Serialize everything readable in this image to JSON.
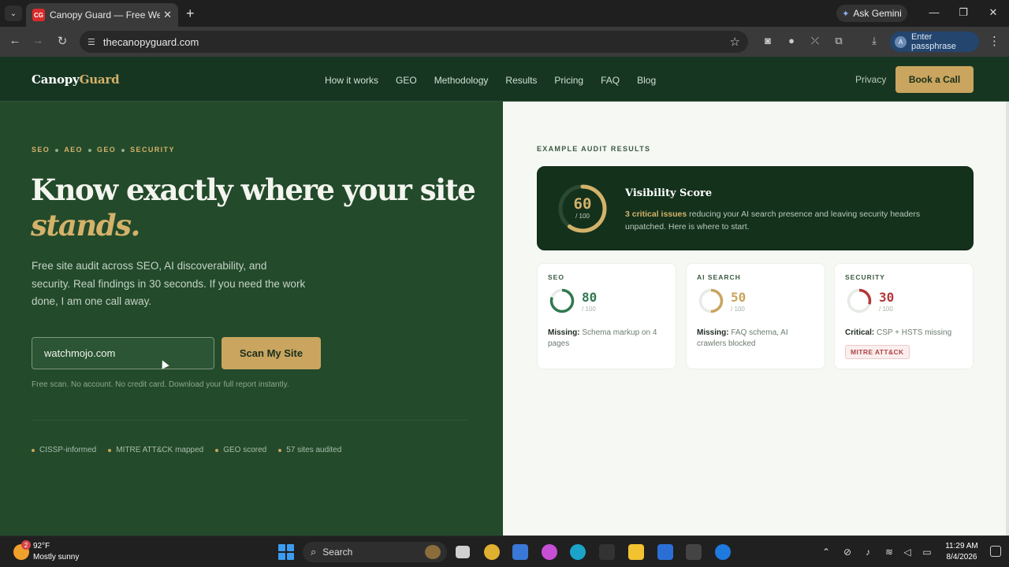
{
  "browser": {
    "tab_favicon": "CG",
    "tab_title": "Canopy Guard — Free Website",
    "tab_close": "✕",
    "new_tab": "+",
    "gemini_label": "Ask Gemini",
    "url": "thecanopyguard.com",
    "passphrase_avatar": "A",
    "passphrase_label": "Enter passphrase"
  },
  "site": {
    "logo_part1": "Canopy",
    "logo_part2": "Guard",
    "nav": [
      "How it works",
      "GEO",
      "Methodology",
      "Results",
      "Pricing",
      "FAQ",
      "Blog"
    ],
    "privacy": "Privacy",
    "book_call": "Book a Call",
    "hero": {
      "eyebrow": [
        "SEO",
        "AEO",
        "GEO",
        "SECURITY"
      ],
      "headline_line1": "Know exactly where your site",
      "headline_line2": "stands.",
      "lede": "Free site audit across SEO, AI discoverability, and security. Real findings in 30 seconds. If you need the work done, I am one call away.",
      "input_value": "watchmojo.com",
      "scan_button": "Scan My Site",
      "fineprint": "Free scan. No account. No credit card. Download your full report instantly.",
      "badges": [
        "CISSP-informed",
        "MITRE ATT&CK mapped",
        "GEO scored",
        "57 sites audited"
      ]
    },
    "audit": {
      "label": "EXAMPLE AUDIT RESULTS",
      "visibility": {
        "score": "60",
        "out_of": "/ 100",
        "score_value": 60,
        "title": "Visibility Score",
        "highlight": "3 critical issues",
        "desc": " reducing your AI search presence and leaving security headers unpatched. Here is where to start."
      },
      "cards": [
        {
          "label": "SEO",
          "score": "80",
          "score_value": 80,
          "out_of": "/ 100",
          "note_bold": "Missing:",
          "note": " Schema markup on 4 pages",
          "color": "#2f7a4f"
        },
        {
          "label": "AI SEARCH",
          "score": "50",
          "score_value": 50,
          "out_of": "/ 100",
          "note_bold": "Missing:",
          "note": " FAQ schema, AI crawlers blocked",
          "color": "#c9a55f"
        },
        {
          "label": "SECURITY",
          "score": "30",
          "score_value": 30,
          "out_of": "/ 100",
          "note_bold": "Critical:",
          "note": " CSP + HSTS missing",
          "color": "#b23a3a",
          "tag": "MITRE ATT&CK"
        }
      ]
    }
  },
  "taskbar": {
    "weather_badge": "2",
    "weather_temp": "92°F",
    "weather_desc": "Mostly sunny",
    "search_label": "Search",
    "time": "11:29 AM",
    "date": "8/4/2026"
  }
}
